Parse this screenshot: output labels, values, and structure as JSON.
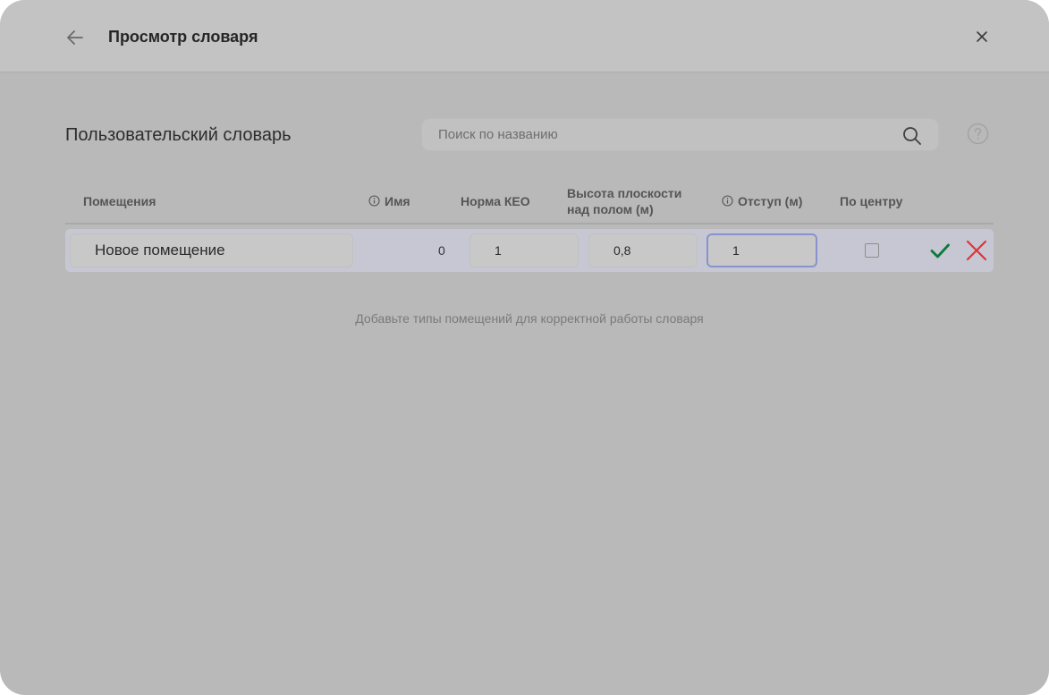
{
  "dialog": {
    "title": "Просмотр словаря"
  },
  "section": {
    "title": "Пользовательский словарь"
  },
  "search": {
    "placeholder": "Поиск по названию",
    "value": ""
  },
  "table": {
    "headers": {
      "rooms": "Помещения",
      "name": "Имя",
      "keo": "Норма КЕО",
      "height_line1": "Высота плоскости",
      "height_line2": "над полом (м)",
      "offset": "Отступ (м)",
      "center": "По центру"
    },
    "row": {
      "room_name": "Новое помещение",
      "name_value": "0",
      "keo": "1",
      "height": "0,8",
      "offset": "1",
      "centered": false
    }
  },
  "empty_hint": "Добавьте типы помещений для корректной работы словаря",
  "icons": {
    "back": "arrow-left-icon",
    "close": "close-icon",
    "search": "search-icon",
    "help": "question-circle-icon",
    "info": "info-circle-icon",
    "confirm": "checkmark-icon",
    "cancel": "cross-icon"
  },
  "colors": {
    "confirm": "#0a7a3a",
    "cancel": "#e0333a",
    "active_border": "#8893cc"
  }
}
